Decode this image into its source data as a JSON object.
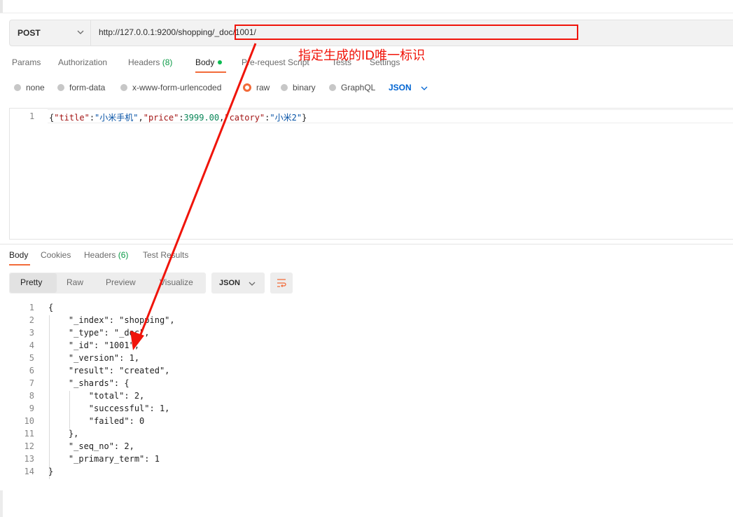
{
  "request": {
    "method": "POST",
    "url": "http://127.0.0.1:9200/shopping/_doc/1001/"
  },
  "request_tabs": {
    "params": "Params",
    "authorization": "Authorization",
    "headers": "Headers",
    "headers_count": "(8)",
    "body": "Body",
    "pre_request": "Pre-request Script",
    "tests": "Tests",
    "settings": "Settings"
  },
  "body_types": {
    "none": "none",
    "form_data": "form-data",
    "urlencoded": "x-www-form-urlencoded",
    "raw": "raw",
    "binary": "binary",
    "graphql": "GraphQL",
    "format": "JSON",
    "selected": "raw"
  },
  "request_body": {
    "line_number": "1",
    "parts": [
      "{",
      "\"title\"",
      ":",
      "\"小米手机\"",
      ",",
      "\"price\"",
      ":",
      "3999.00",
      ",",
      "\"catory\"",
      ":",
      "\"小米2\"",
      "}"
    ]
  },
  "response_tabs": {
    "body": "Body",
    "cookies": "Cookies",
    "headers": "Headers",
    "headers_count": "(6)",
    "test_results": "Test Results"
  },
  "view_modes": {
    "pretty": "Pretty",
    "raw": "Raw",
    "preview": "Preview",
    "visualize": "Visualize",
    "format": "JSON"
  },
  "response_body": {
    "line_numbers": [
      "1",
      "2",
      "3",
      "4",
      "5",
      "6",
      "7",
      "8",
      "9",
      "10",
      "11",
      "12",
      "13",
      "14"
    ],
    "lines": [
      "{",
      "    \"_index\": \"shopping\",",
      "    \"_type\": \"_doc\",",
      "    \"_id\": \"1001\",",
      "    \"_version\": 1,",
      "    \"result\": \"created\",",
      "    \"_shards\": {",
      "        \"total\": 2,",
      "        \"successful\": 1,",
      "        \"failed\": 0",
      "    },",
      "    \"_seq_no\": 2,",
      "    \"_primary_term\": 1",
      "}"
    ]
  },
  "annotation": {
    "text": "指定生成的ID唯一标识",
    "color": "#f0140a"
  },
  "colors": {
    "accent": "#f26b3a",
    "link": "#0265d2",
    "success": "#0cbb52"
  }
}
